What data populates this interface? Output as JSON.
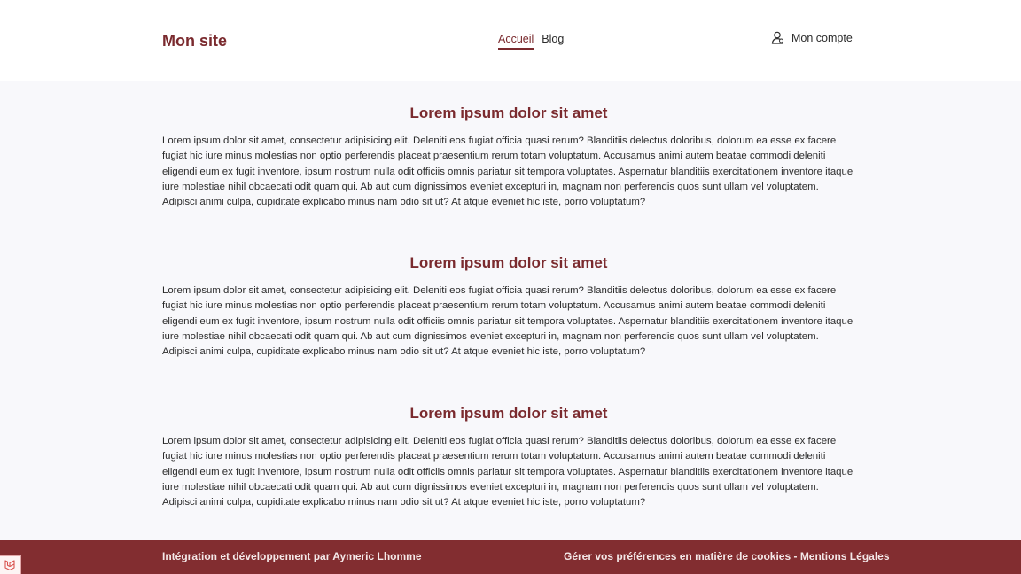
{
  "header": {
    "brand": "Mon site",
    "nav": [
      {
        "label": "Accueil",
        "active": true
      },
      {
        "label": "Blog",
        "active": false
      }
    ],
    "account": {
      "icon": "user-icon",
      "label": "Mon compte"
    }
  },
  "articles": [
    {
      "title": "Lorem ipsum dolor sit amet",
      "body": "Lorem ipsum dolor sit amet, consectetur adipisicing elit. Deleniti eos fugiat officia quasi rerum? Blanditiis delectus doloribus, dolorum ea esse ex facere fugiat hic iure minus molestias non optio perferendis placeat praesentium rerum totam voluptatum. Accusamus animi autem beatae commodi deleniti eligendi eum ex fugit inventore, ipsum nostrum nulla odit officiis omnis pariatur sit tempora voluptates. Aspernatur blanditiis exercitationem inventore itaque iure molestiae nihil obcaecati odit quam qui. Ab aut cum dignissimos eveniet excepturi in, magnam non perferendis quos sunt ullam vel voluptatem. Adipisci animi culpa, cupiditate explicabo minus nam odio sit ut? At atque eveniet hic iste, porro voluptatum?"
    },
    {
      "title": "Lorem ipsum dolor sit amet",
      "body": "Lorem ipsum dolor sit amet, consectetur adipisicing elit. Deleniti eos fugiat officia quasi rerum? Blanditiis delectus doloribus, dolorum ea esse ex facere fugiat hic iure minus molestias non optio perferendis placeat praesentium rerum totam voluptatum. Accusamus animi autem beatae commodi deleniti eligendi eum ex fugit inventore, ipsum nostrum nulla odit officiis omnis pariatur sit tempora voluptates. Aspernatur blanditiis exercitationem inventore itaque iure molestiae nihil obcaecati odit quam qui. Ab aut cum dignissimos eveniet excepturi in, magnam non perferendis quos sunt ullam vel voluptatem. Adipisci animi culpa, cupiditate explicabo minus nam odio sit ut? At atque eveniet hic iste, porro voluptatum?"
    },
    {
      "title": "Lorem ipsum dolor sit amet",
      "body": "Lorem ipsum dolor sit amet, consectetur adipisicing elit. Deleniti eos fugiat officia quasi rerum? Blanditiis delectus doloribus, dolorum ea esse ex facere fugiat hic iure minus molestias non optio perferendis placeat praesentium rerum totam voluptatum. Accusamus animi autem beatae commodi deleniti eligendi eum ex fugit inventore, ipsum nostrum nulla odit officiis omnis pariatur sit tempora voluptates. Aspernatur blanditiis exercitationem inventore itaque iure molestiae nihil obcaecati odit quam qui. Ab aut cum dignissimos eveniet excepturi in, magnam non perferendis quos sunt ullam vel voluptatem. Adipisci animi culpa, cupiditate explicabo minus nam odio sit ut? At atque eveniet hic iste, porro voluptatum?"
    }
  ],
  "footer": {
    "credit": "Intégration et développement par Aymeric Lhomme",
    "cookies_link": "Gérer vos préférences en matière de cookies",
    "separator": " - ",
    "legal_link": "Mentions Légales"
  },
  "badge": {
    "icon": "framework-logo-icon"
  },
  "colors": {
    "accent": "#7a2a2e",
    "footer_bg": "#822d30",
    "main_bg": "#f8f8fb"
  }
}
